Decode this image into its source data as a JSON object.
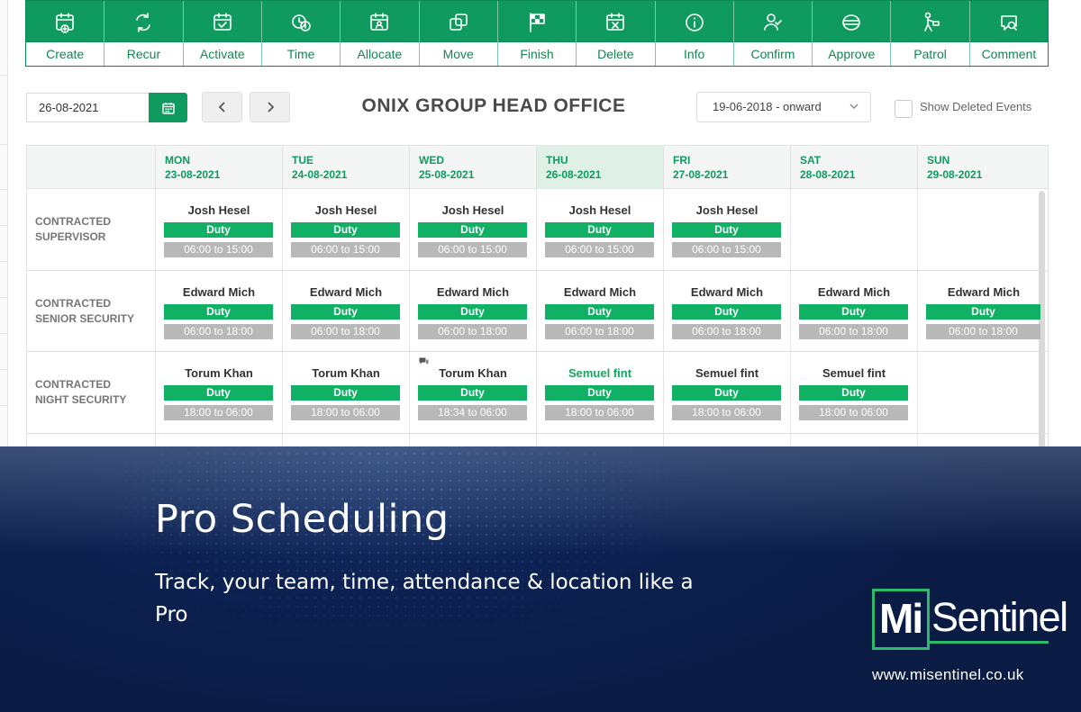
{
  "toolbar": {
    "items": [
      {
        "label": "Create",
        "icon": "calendar-plus-icon"
      },
      {
        "label": "Recur",
        "icon": "recur-arrows-icon"
      },
      {
        "label": "Activate",
        "icon": "calendar-check-icon"
      },
      {
        "label": "Time",
        "icon": "clock-icon"
      },
      {
        "label": "Allocate",
        "icon": "calendar-user-icon"
      },
      {
        "label": "Move",
        "icon": "move-copy-icon"
      },
      {
        "label": "Finish",
        "icon": "checkered-flag-icon"
      },
      {
        "label": "Delete",
        "icon": "calendar-x-icon"
      },
      {
        "label": "Info",
        "icon": "info-icon"
      },
      {
        "label": "Confirm",
        "icon": "user-check-icon"
      },
      {
        "label": "Approve",
        "icon": "approve-stamp-icon"
      },
      {
        "label": "Patrol",
        "icon": "patrol-guard-icon"
      },
      {
        "label": "Comment",
        "icon": "comment-search-icon"
      }
    ]
  },
  "controls": {
    "date_value": "26-08-2021",
    "office_title": "ONIX GROUP HEAD OFFICE",
    "range_value": "19-06-2018 - onward",
    "show_deleted_label": "Show Deleted Events"
  },
  "schedule": {
    "days": [
      {
        "day": "MON",
        "date": "23-08-2021"
      },
      {
        "day": "TUE",
        "date": "24-08-2021"
      },
      {
        "day": "WED",
        "date": "25-08-2021"
      },
      {
        "day": "THU",
        "date": "26-08-2021",
        "today": true
      },
      {
        "day": "FRI",
        "date": "27-08-2021"
      },
      {
        "day": "SAT",
        "date": "28-08-2021"
      },
      {
        "day": "SUN",
        "date": "29-08-2021"
      }
    ],
    "rows": [
      {
        "label_line1": "CONTRACTED",
        "label_line2": "SUPERVISOR",
        "shifts": [
          {
            "name": "Josh Hesel",
            "type": "Duty",
            "time": "06:00 to 15:00"
          },
          {
            "name": "Josh Hesel",
            "type": "Duty",
            "time": "06:00 to 15:00"
          },
          {
            "name": "Josh Hesel",
            "type": "Duty",
            "time": "06:00 to 15:00"
          },
          {
            "name": "Josh Hesel",
            "type": "Duty",
            "time": "06:00 to 15:00"
          },
          {
            "name": "Josh Hesel",
            "type": "Duty",
            "time": "06:00 to 15:00"
          },
          null,
          null
        ]
      },
      {
        "label_line1": "CONTRACTED",
        "label_line2": "SENIOR SECURITY",
        "shifts": [
          {
            "name": "Edward Mich",
            "type": "Duty",
            "time": "06:00 to 18:00"
          },
          {
            "name": "Edward Mich",
            "type": "Duty",
            "time": "06:00 to 18:00"
          },
          {
            "name": "Edward Mich",
            "type": "Duty",
            "time": "06:00 to 18:00"
          },
          {
            "name": "Edward Mich",
            "type": "Duty",
            "time": "06:00 to 18:00"
          },
          {
            "name": "Edward Mich",
            "type": "Duty",
            "time": "06:00 to 18:00"
          },
          {
            "name": "Edward Mich",
            "type": "Duty",
            "time": "06:00 to 18:00"
          },
          {
            "name": "Edward Mich",
            "type": "Duty",
            "time": "06:00 to 18:00"
          }
        ]
      },
      {
        "label_line1": "CONTRACTED",
        "label_line2": "NIGHT SECURITY",
        "shifts": [
          {
            "name": "Torum Khan",
            "type": "Duty",
            "time": "18:00 to 06:00"
          },
          {
            "name": "Torum Khan",
            "type": "Duty",
            "time": "18:00 to 06:00"
          },
          {
            "name": "Torum Khan",
            "type": "Duty",
            "time": "18:34 to 06:00",
            "comment": true
          },
          {
            "name": "Semuel fint",
            "type": "Duty",
            "time": "18:00 to 06:00",
            "highlight": true
          },
          {
            "name": "Semuel fint",
            "type": "Duty",
            "time": "18:00 to 06:00"
          },
          {
            "name": "Semuel fint",
            "type": "Duty",
            "time": "18:00 to 06:00"
          },
          null
        ]
      }
    ]
  },
  "banner": {
    "title": "Pro Scheduling",
    "subtitle": "Track, your team, time, attendance & location like a Pro",
    "logo_mi": "Mi",
    "logo_sentinel": "Sentinel",
    "website": "www.misentinel.co.uk"
  },
  "colors": {
    "brand_green": "#0f9a5f",
    "duty_green": "#10b065",
    "banner_navy": "#0d2252"
  }
}
